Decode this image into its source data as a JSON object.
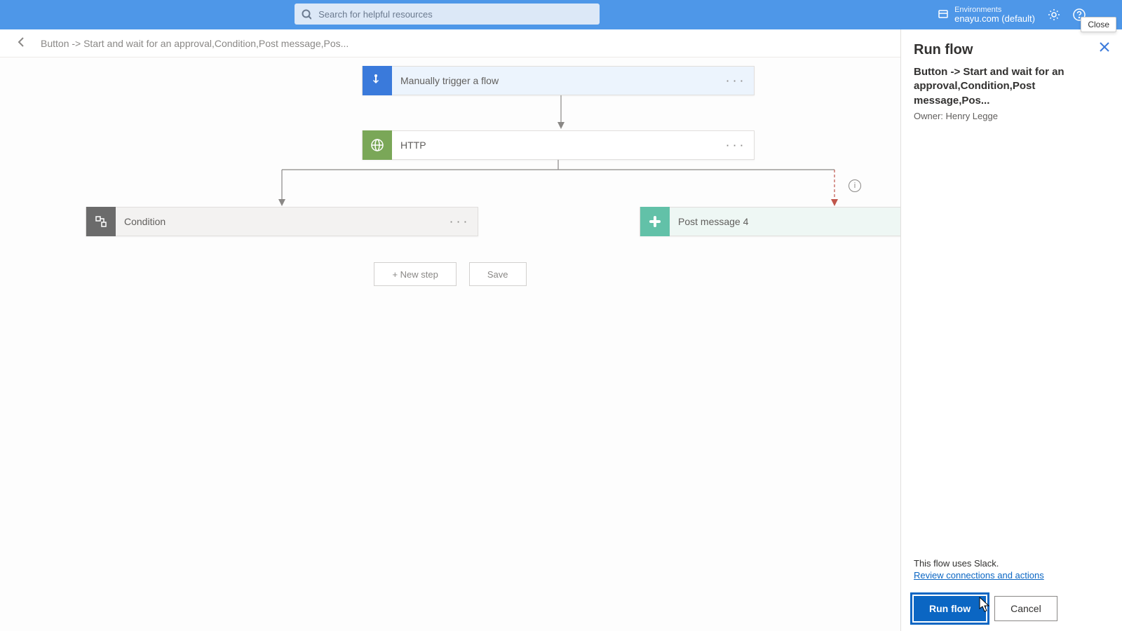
{
  "header": {
    "search_placeholder": "Search for helpful resources",
    "env_label": "Environments",
    "env_value": "enayu.com (default)",
    "close_tooltip": "Close"
  },
  "breadcrumb": {
    "text": "Button -> Start and wait for an approval,Condition,Post message,Pos..."
  },
  "nodes": {
    "trigger": {
      "label": "Manually trigger a flow"
    },
    "http": {
      "label": "HTTP"
    },
    "condition": {
      "label": "Condition"
    },
    "post": {
      "label": "Post message 4"
    }
  },
  "canvas_buttons": {
    "new_step": "+ New step",
    "save": "Save"
  },
  "panel": {
    "title": "Run flow",
    "flow_name": "Button -> Start and wait for an approval,Condition,Post message,Pos...",
    "owner": "Owner: Henry Legge",
    "note": "This flow uses Slack.",
    "review_link": "Review connections and actions",
    "run_btn": "Run flow",
    "cancel_btn": "Cancel"
  },
  "info_icon": "i"
}
